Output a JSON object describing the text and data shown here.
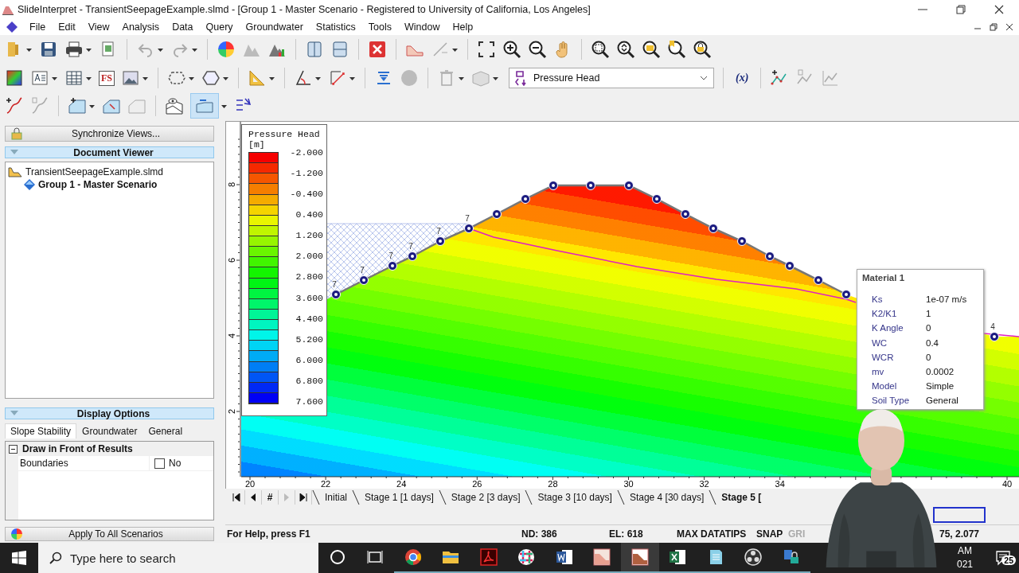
{
  "window": {
    "title": "SlideInterpret - TransientSeepageExample.slmd - [Group 1 - Master Scenario - Registered to University of California, Los Angeles]"
  },
  "menu": [
    "File",
    "Edit",
    "View",
    "Analysis",
    "Data",
    "Query",
    "Groundwater",
    "Statistics",
    "Tools",
    "Window",
    "Help"
  ],
  "toolbar": {
    "fs_label": "FS",
    "function_label": "(x)",
    "result_type": "Pressure Head",
    "water_table_tool": {
      "selected": true
    }
  },
  "sidebar": {
    "sync_button": "Synchronize Views...",
    "document_viewer": {
      "title": "Document Viewer",
      "tree": [
        {
          "label": "TransientSeepageExample.slmd",
          "selected": false,
          "children": [
            {
              "label": "Group 1 - Master Scenario",
              "selected": true
            }
          ]
        }
      ]
    },
    "display_options": {
      "title": "Display Options",
      "tabs": [
        {
          "label": "Slope Stability",
          "selected": true
        },
        {
          "label": "Groundwater",
          "selected": false
        },
        {
          "label": "General",
          "selected": false
        }
      ],
      "sections": [
        {
          "title": "Draw in Front of Results",
          "expanded": true,
          "rows": [
            {
              "label": "Boundaries",
              "checked": false,
              "value": "No"
            }
          ]
        }
      ]
    },
    "apply_button": "Apply To All Scenarios"
  },
  "view": {
    "legend": {
      "title": "Pressure Head",
      "unit": "[m]",
      "values": [
        "-2.000",
        "-1.200",
        "-0.400",
        "0.400",
        "1.200",
        "2.000",
        "2.800",
        "3.600",
        "4.400",
        "5.200",
        "6.000",
        "6.800",
        "7.600"
      ]
    },
    "x_ticks": [
      "20",
      "22",
      "24",
      "26",
      "28",
      "30",
      "32",
      "34",
      "40"
    ],
    "y_ticks": [
      "8",
      "6",
      "4",
      "2"
    ],
    "node_labels": [
      "7",
      "7",
      "7",
      "7",
      "7",
      "7",
      "4"
    ],
    "material_popup": {
      "title": "Material 1",
      "rows": [
        {
          "label": "Ks",
          "value": "1e-07 m/s"
        },
        {
          "label": "K2/K1",
          "value": "1"
        },
        {
          "label": "K Angle",
          "value": "0"
        },
        {
          "label": "WC",
          "value": "0.4"
        },
        {
          "label": "WCR",
          "value": "0"
        },
        {
          "label": "mv",
          "value": "0.0002"
        },
        {
          "label": "Model",
          "value": "Simple"
        },
        {
          "label": "Soil Type",
          "value": "General"
        }
      ]
    }
  },
  "stages": {
    "page_button": "#",
    "tabs": [
      {
        "label": "Initial",
        "selected": false
      },
      {
        "label": "Stage 1 [1 days]",
        "selected": false
      },
      {
        "label": "Stage 2 [3 days]",
        "selected": false
      },
      {
        "label": "Stage 3 [10 days]",
        "selected": false
      },
      {
        "label": "Stage 4 [30 days]",
        "selected": false
      },
      {
        "label": "Stage 5 [",
        "selected": true
      }
    ]
  },
  "status_bar": {
    "help": "For Help, press F1",
    "panes": [
      {
        "text": "ND: 386",
        "enabled": true
      },
      {
        "text": "EL: 618",
        "enabled": true
      },
      {
        "text": "MAX DATATIPS",
        "enabled": true
      },
      {
        "text": "SNAP",
        "enabled": true
      },
      {
        "text": "GRI",
        "enabled": false
      },
      {
        "text": "75, 2.077",
        "enabled": true
      }
    ]
  },
  "taskbar": {
    "search": {
      "placeholder": "Type here to search"
    },
    "clock": [
      "AM",
      "021"
    ],
    "notifications": "25"
  }
}
